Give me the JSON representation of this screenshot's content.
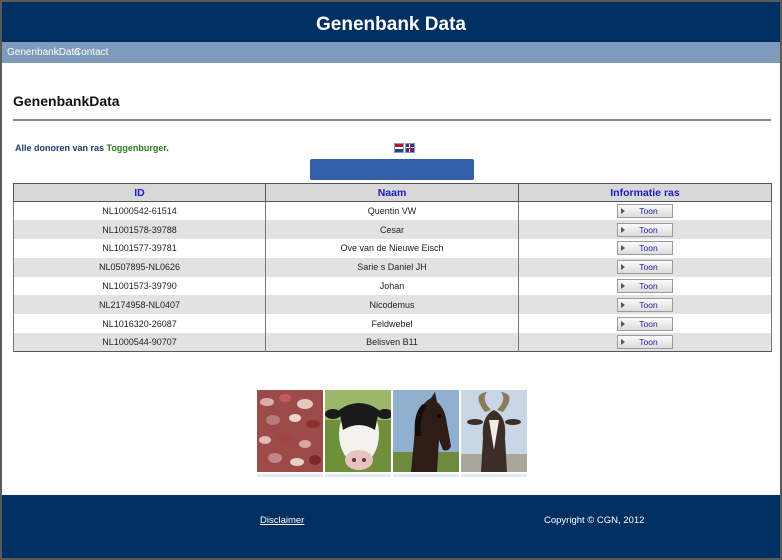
{
  "header": {
    "title": "Genenbank Data"
  },
  "nav": {
    "items": [
      {
        "label": "GenenbankData"
      },
      {
        "label": "Contact"
      }
    ]
  },
  "main": {
    "page_title": "GenenbankData",
    "intro_text": "Alle donoren van ras ",
    "breed": "Toggenburger",
    "intro_suffix": "."
  },
  "languages": [
    {
      "icon": "dutch-flag-icon"
    },
    {
      "icon": "uk-flag-icon"
    }
  ],
  "colors": {
    "header_bg": "#002f62",
    "nav_bg": "#7e9bbb",
    "bar_blue": "#3060a8",
    "breed_green": "#2c7a1e",
    "header_text": "#1a1acc"
  },
  "table": {
    "columns": [
      "ID",
      "Naam",
      "Informatie ras"
    ],
    "button_label": "Toon",
    "rows": [
      {
        "id": "NL1000542-61514",
        "naam": "Quentin VW"
      },
      {
        "id": "NL1001578-39788",
        "naam": "Cesar"
      },
      {
        "id": "NL1001577-39781",
        "naam": "Ove van de Nieuwe Eisch"
      },
      {
        "id": "NL0507895-NL0626",
        "naam": "Sarie s Daniel JH"
      },
      {
        "id": "NL1001573-39790",
        "naam": "Johan"
      },
      {
        "id": "NL2174958-NL0407",
        "naam": "Nicodemus"
      },
      {
        "id": "NL1016320-26087",
        "naam": "Feldwebel"
      },
      {
        "id": "NL1000544-90707",
        "naam": "Belisven B11"
      }
    ]
  },
  "photos": [
    {
      "subject": "seeds"
    },
    {
      "subject": "cow"
    },
    {
      "subject": "horse"
    },
    {
      "subject": "goat"
    }
  ],
  "footer": {
    "disclaimer": "Disclaimer",
    "copyright": "Copyright © CGN, 2012"
  }
}
